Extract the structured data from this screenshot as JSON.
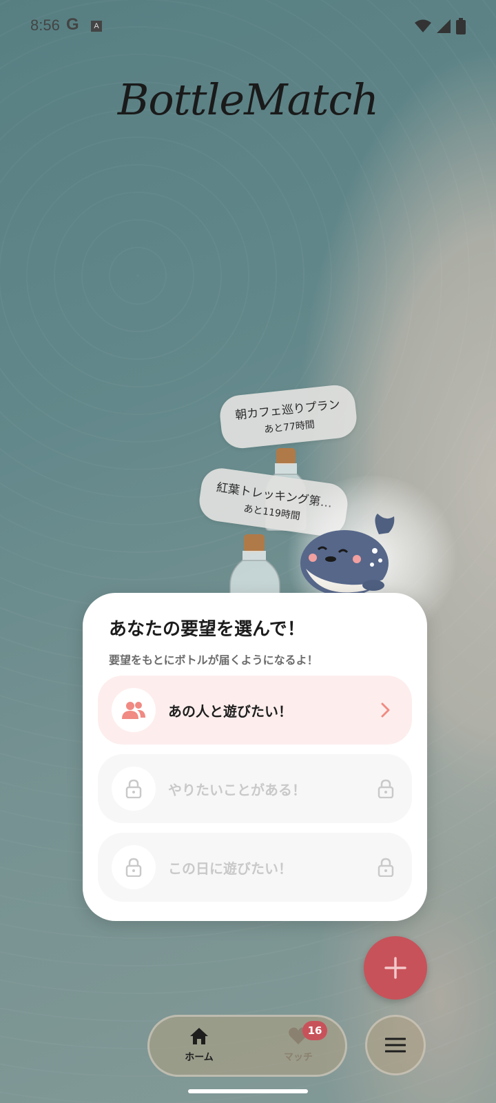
{
  "status_bar": {
    "time": "8:56",
    "g_label": "G",
    "a_label": "A"
  },
  "app": {
    "title": "BottleMatch"
  },
  "bottles": [
    {
      "title": "朝カフェ巡りプラン",
      "remaining": "あと77時間"
    },
    {
      "title": "紅葉トレッキング第…",
      "remaining": "あと119時間"
    }
  ],
  "modal": {
    "title": "あなたの要望を選んで！",
    "subtitle": "要望をもとにボトルが届くようになるよ！",
    "options": [
      {
        "label": "あの人と遊びたい！",
        "icon": "people-icon",
        "locked": false
      },
      {
        "label": "やりたいことがある！",
        "icon": "lock-icon",
        "locked": true
      },
      {
        "label": "この日に遊びたい！",
        "icon": "lock-icon",
        "locked": true
      }
    ]
  },
  "fab": {
    "icon": "plus-icon"
  },
  "nav": {
    "home_label": "ホーム",
    "match_label": "マッチ",
    "match_badge": "16",
    "menu_icon": "hamburger-icon"
  },
  "colors": {
    "accent": "#c8525a",
    "option_active_bg": "#fdeeed",
    "option_locked_bg": "#f7f7f7",
    "people_icon": "#f08a82"
  }
}
